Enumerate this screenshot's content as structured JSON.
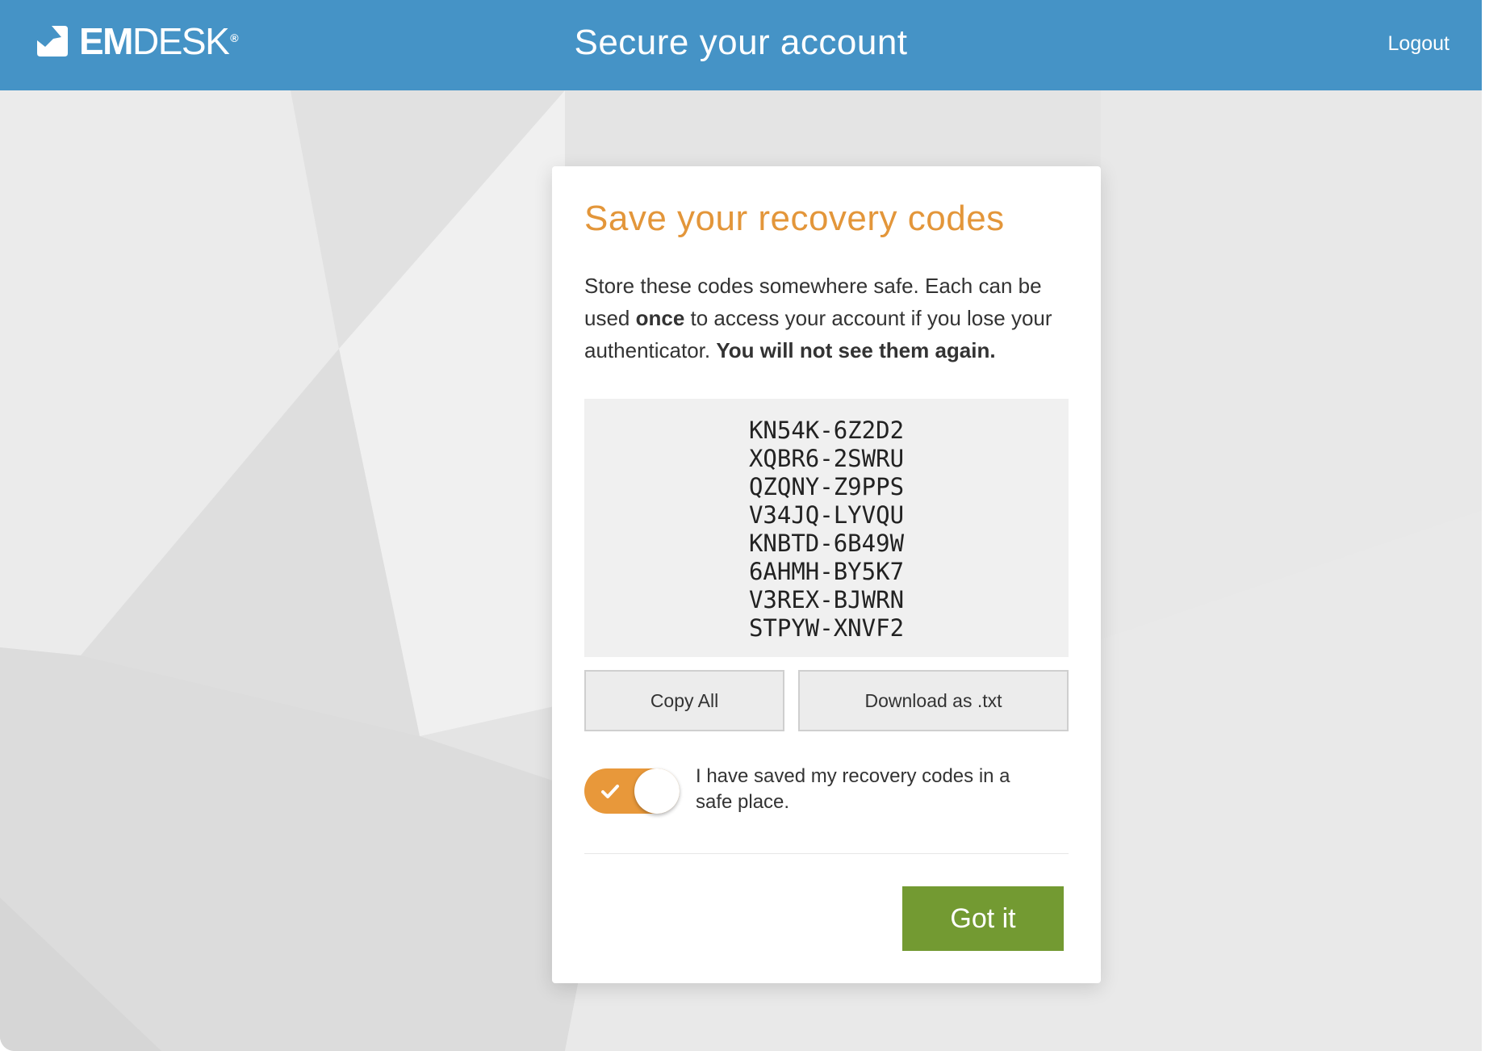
{
  "header": {
    "logo_bold": "EM",
    "logo_light": "DESK",
    "logo_mark": "®",
    "title": "Secure your account",
    "logout_label": "Logout"
  },
  "card": {
    "title": "Save your recovery codes",
    "desc_part1": "Store these codes somewhere safe. Each can be used ",
    "desc_bold1": "once",
    "desc_part2": " to access your account if you lose your authenticator. ",
    "desc_bold2": "You will not see them again.",
    "codes": [
      "KN54K-6Z2D2",
      "XQBR6-2SWRU",
      "QZQNY-Z9PPS",
      "V34JQ-LYVQU",
      "KNBTD-6B49W",
      "6AHMH-BY5K7",
      "V3REX-BJWRN",
      "STPYW-XNVF2"
    ],
    "copy_label": "Copy All",
    "download_label": "Download as .txt",
    "toggle_on": true,
    "toggle_label": "I have saved my recovery codes in a safe place.",
    "confirm_label": "Got it"
  },
  "colors": {
    "header_blue": "#4593c6",
    "title_orange": "#e3963a",
    "toggle_orange": "#e8983a",
    "confirm_green": "#739a32"
  }
}
